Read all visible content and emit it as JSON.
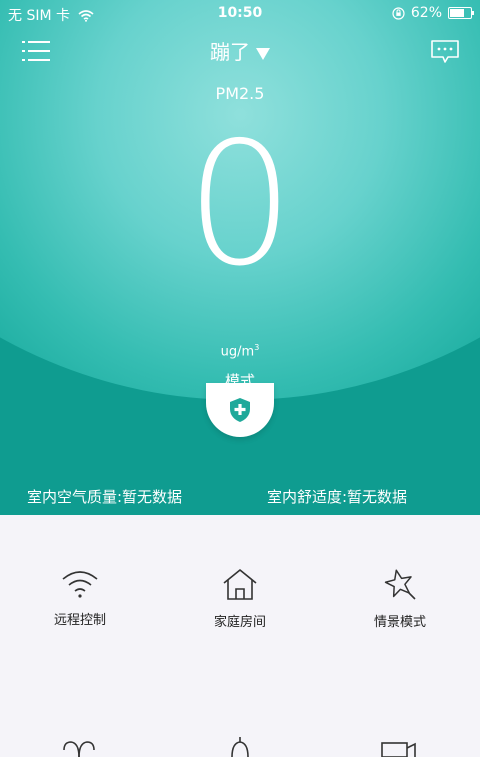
{
  "status_bar": {
    "carrier": "无 SIM 卡",
    "time": "10:50",
    "battery": "62%"
  },
  "header": {
    "title": "蹦了"
  },
  "reading": {
    "label": "PM2.5",
    "value": "0",
    "unit": "ug/m",
    "unit_sup": "3"
  },
  "mode": {
    "label": "模式"
  },
  "indicators": {
    "air_quality": "室内空气质量:暂无数据",
    "comfort": "室内舒适度:暂无数据"
  },
  "features": [
    {
      "label": "远程控制",
      "icon": "wifi-icon"
    },
    {
      "label": "家庭房间",
      "icon": "house-icon"
    },
    {
      "label": "情景模式",
      "icon": "star-icon"
    }
  ],
  "colors": {
    "primary": "#0f9c90",
    "light": "#8fe0dc",
    "background": "#f5f4f9"
  }
}
